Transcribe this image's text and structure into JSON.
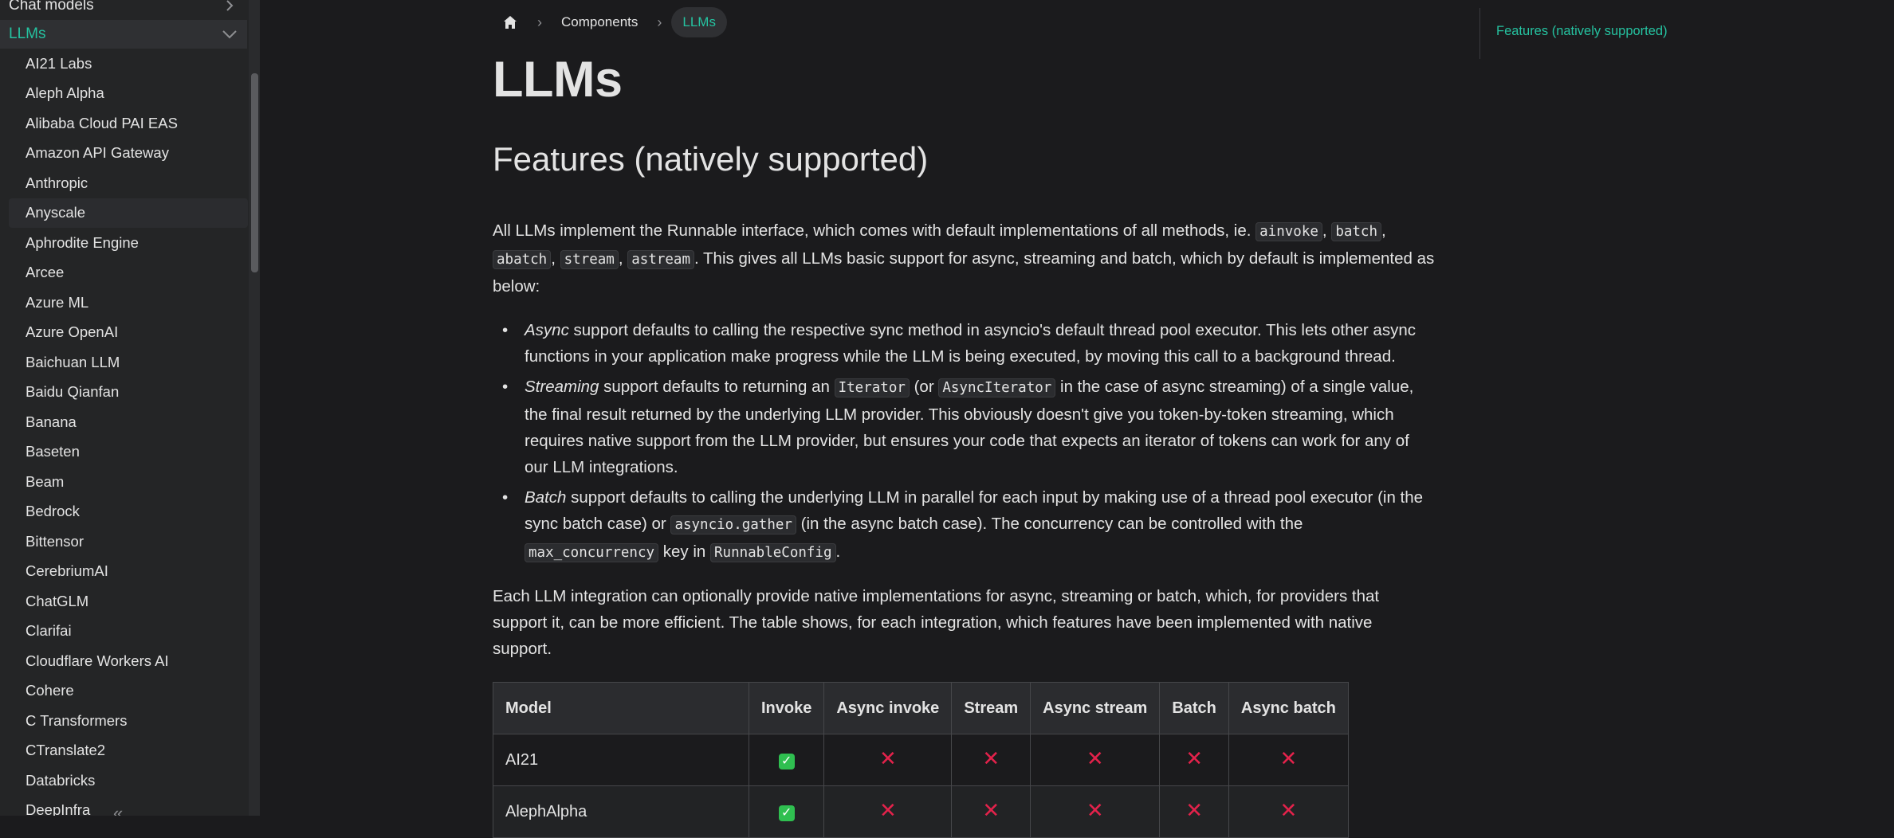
{
  "sidebar": {
    "category_prev": "Chat models",
    "category_active": "LLMs",
    "items": [
      "AI21 Labs",
      "Aleph Alpha",
      "Alibaba Cloud PAI EAS",
      "Amazon API Gateway",
      "Anthropic",
      "Anyscale",
      "Aphrodite Engine",
      "Arcee",
      "Azure ML",
      "Azure OpenAI",
      "Baichuan LLM",
      "Baidu Qianfan",
      "Banana",
      "Baseten",
      "Beam",
      "Bedrock",
      "Bittensor",
      "CerebriumAI",
      "ChatGLM",
      "Clarifai",
      "Cloudflare Workers AI",
      "Cohere",
      "C Transformers",
      "CTranslate2",
      "Databricks",
      "DeepInfra"
    ]
  },
  "breadcrumb": {
    "components": "Components",
    "current": "LLMs"
  },
  "page": {
    "title": "LLMs",
    "section_title": "Features (natively supported)",
    "intro": {
      "t1": "All LLMs implement the Runnable interface, which comes with default implementations of all methods, ie. ",
      "c1": "ainvoke",
      "c2": "batch",
      "c3": "abatch",
      "c4": "stream",
      "c5": "astream",
      "t2": ". This gives all LLMs basic support for async, streaming and batch, which by default is implemented as below:"
    },
    "bullets": {
      "async_em": "Async",
      "async_text": " support defaults to calling the respective sync method in asyncio's default thread pool executor. This lets other async functions in your application make progress while the LLM is being executed, by moving this call to a background thread.",
      "stream_em": "Streaming",
      "stream_t1": " support defaults to returning an ",
      "stream_c1": "Iterator",
      "stream_t2": " (or ",
      "stream_c2": "AsyncIterator",
      "stream_t3": " in the case of async streaming) of a single value, the final result returned by the underlying LLM provider. This obviously doesn't give you token-by-token streaming, which requires native support from the LLM provider, but ensures your code that expects an iterator of tokens can work for any of our LLM integrations.",
      "batch_em": "Batch",
      "batch_t1": " support defaults to calling the underlying LLM in parallel for each input by making use of a thread pool executor (in the sync batch case) or ",
      "batch_c1": "asyncio.gather",
      "batch_t2": " (in the async batch case). The concurrency can be controlled with the ",
      "batch_c2": "max_concurrency",
      "batch_t3": " key in ",
      "batch_c3": "RunnableConfig",
      "batch_t4": "."
    },
    "outro": "Each LLM integration can optionally provide native implementations for async, streaming or batch, which, for providers that support it, can be more efficient. The table shows, for each integration, which features have been implemented with native support."
  },
  "table": {
    "headers": [
      "Model",
      "Invoke",
      "Async invoke",
      "Stream",
      "Async stream",
      "Batch",
      "Async batch"
    ],
    "rows": [
      {
        "model": "AI21",
        "values": [
          true,
          false,
          false,
          false,
          false,
          false
        ]
      },
      {
        "model": "AlephAlpha",
        "values": [
          true,
          false,
          false,
          false,
          false,
          false
        ]
      }
    ]
  },
  "toc": {
    "link": "Features (natively supported)"
  },
  "icons": {
    "check": "check-icon",
    "cross": "cross-icon",
    "home": "home-icon"
  },
  "colors": {
    "accent": "#25c2a0",
    "check": "#2fbf50",
    "cross": "#e3224b",
    "background": "#1b1b1d"
  }
}
